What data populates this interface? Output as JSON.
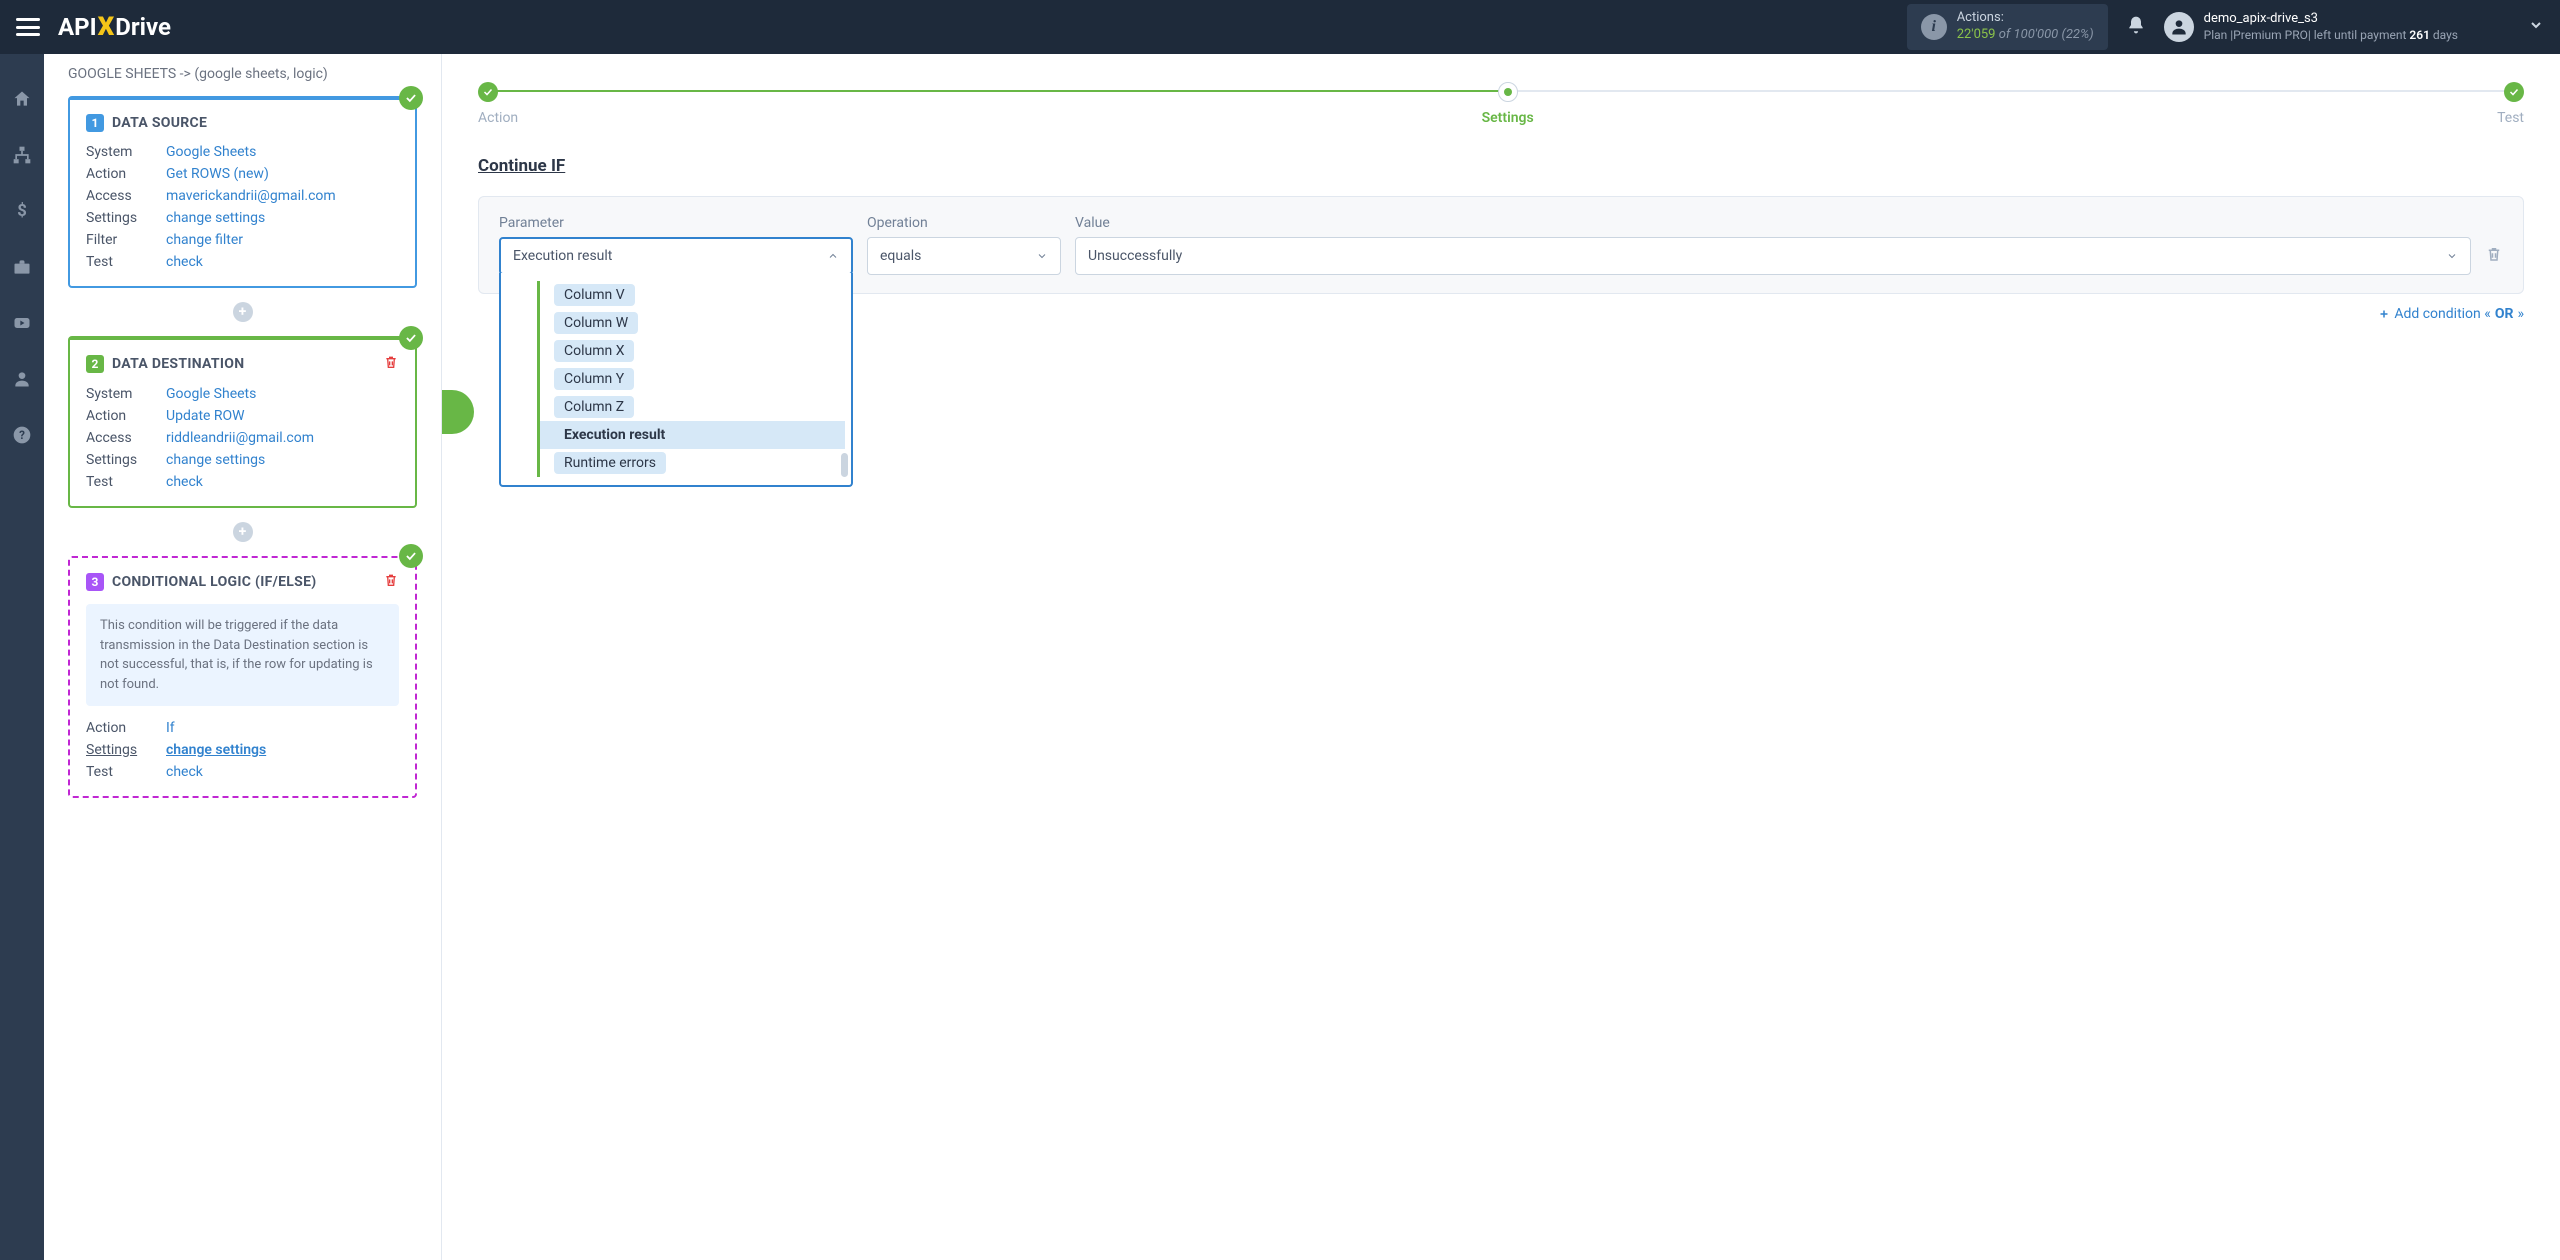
{
  "header": {
    "logo_pre": "API",
    "logo_x": "X",
    "logo_post": "Drive",
    "actions_label": "Actions:",
    "actions_used": "22'059",
    "actions_of": "of",
    "actions_total": "100'000",
    "actions_pct": "(22%)",
    "user_name": "demo_apix-drive_s3",
    "plan_prefix": "Plan |Premium PRO| left until payment ",
    "plan_days": "261",
    "plan_suffix": " days"
  },
  "breadcrumb": "GOOGLE SHEETS -> (google sheets, logic)",
  "card1": {
    "num": "1",
    "title": "DATA SOURCE",
    "rows": {
      "system_l": "System",
      "system_v": "Google Sheets",
      "action_l": "Action",
      "action_v": "Get ROWS (new)",
      "access_l": "Access",
      "access_v": "maverickandrii@gmail.com",
      "settings_l": "Settings",
      "settings_v": "change settings",
      "filter_l": "Filter",
      "filter_v": "change filter",
      "test_l": "Test",
      "test_v": "check"
    }
  },
  "card2": {
    "num": "2",
    "title": "DATA DESTINATION",
    "rows": {
      "system_l": "System",
      "system_v": "Google Sheets",
      "action_l": "Action",
      "action_v": "Update ROW",
      "access_l": "Access",
      "access_v": "riddleandrii@gmail.com",
      "settings_l": "Settings",
      "settings_v": "change settings",
      "test_l": "Test",
      "test_v": "check"
    }
  },
  "card3": {
    "num": "3",
    "title": "CONDITIONAL LOGIC (IF/ELSE)",
    "note": "This condition will be triggered if the data transmission in the Data Destination section is not successful, that is, if the row for updating is not found.",
    "rows": {
      "action_l": "Action",
      "action_v": "If",
      "settings_l": "Settings",
      "settings_v": "change settings",
      "test_l": "Test",
      "test_v": "check"
    }
  },
  "progress": {
    "step1": "Action",
    "step2": "Settings",
    "step3": "Test"
  },
  "section_title": "Continue IF",
  "cond": {
    "param_label": "Parameter",
    "op_label": "Operation",
    "val_label": "Value",
    "param_value": "Execution result",
    "op_value": "equals",
    "val_value": "Unsuccessfully"
  },
  "dropdown": {
    "i0": "Column V",
    "i1": "Column W",
    "i2": "Column X",
    "i3": "Column Y",
    "i4": "Column Z",
    "i5": "Execution result",
    "i6": "Runtime errors"
  },
  "add_or_prefix": "Add condition «",
  "add_or_bold": "OR",
  "add_or_suffix": "»"
}
